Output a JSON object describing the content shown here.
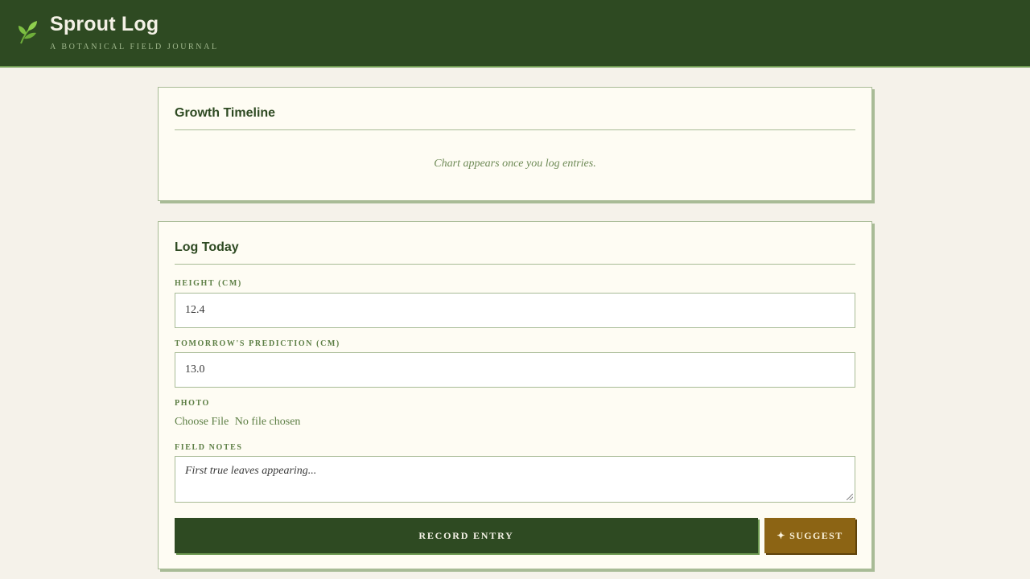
{
  "app": {
    "title": "Sprout Log",
    "subtitle": "A Botanical Field Journal",
    "logo_icon": "leaf-icon"
  },
  "timeline": {
    "title": "Growth Timeline",
    "empty_message": "Chart appears once you log entries."
  },
  "log_form": {
    "title": "Log Today",
    "height_label": "Height (cm)",
    "height_value": "12.4",
    "prediction_label": "Tomorrow's Prediction (cm)",
    "prediction_value": "13.0",
    "photo_label": "Photo",
    "file_button_label": "Choose File",
    "file_status": "No file chosen",
    "notes_label": "Field Notes",
    "notes_placeholder": "First true leaves appearing...",
    "record_button_label": "Record Entry",
    "suggest_button_label": "✦ Suggest"
  },
  "colors": {
    "header_bg": "#2e4a22",
    "accent_green": "#6e9a52",
    "suggest_gold": "#8c6414",
    "page_bg": "#f5f2ea",
    "card_bg": "#fefcf3"
  }
}
